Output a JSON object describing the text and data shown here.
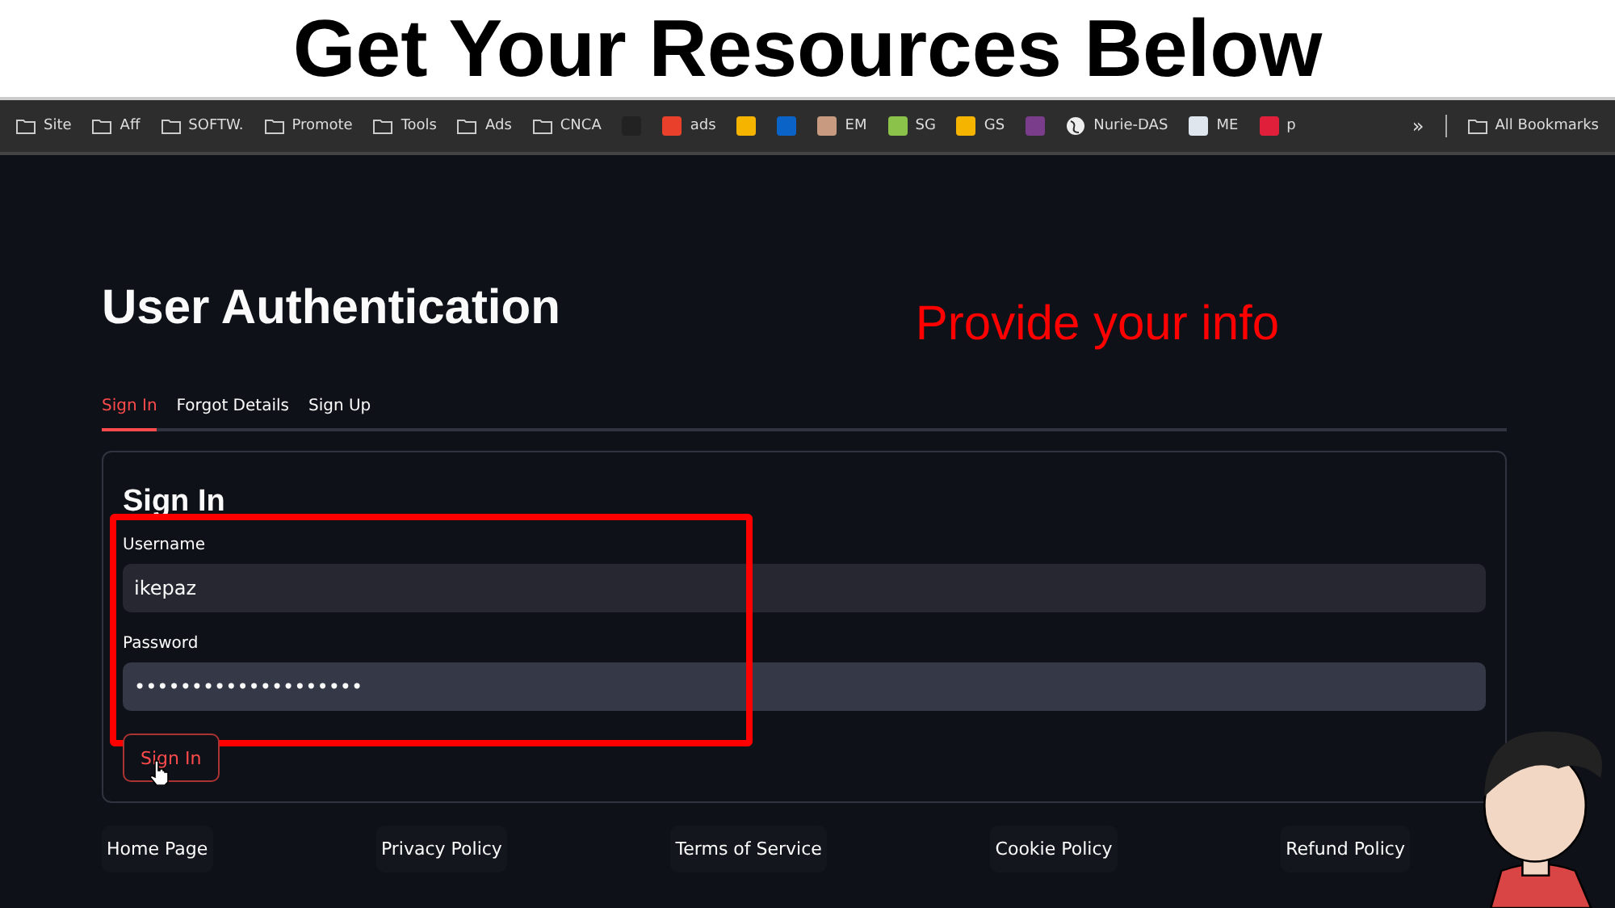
{
  "banner": {
    "title": "Get Your Resources Below"
  },
  "bookmarks": [
    {
      "kind": "folder",
      "label": "Site"
    },
    {
      "kind": "folder",
      "label": "Aff"
    },
    {
      "kind": "folder",
      "label": "SOFTW."
    },
    {
      "kind": "folder",
      "label": "Promote"
    },
    {
      "kind": "folder",
      "label": "Tools"
    },
    {
      "kind": "folder",
      "label": "Ads"
    },
    {
      "kind": "folder",
      "label": "CNCA"
    },
    {
      "kind": "site",
      "color": "#222222"
    },
    {
      "kind": "site",
      "label": "ads",
      "color": "#e8402a"
    },
    {
      "kind": "site",
      "color": "#f4b400"
    },
    {
      "kind": "site",
      "color": "#0a64c8"
    },
    {
      "kind": "site",
      "label": "EM",
      "color": "#c89a80"
    },
    {
      "kind": "site",
      "label": "SG",
      "color": "#8bc34a"
    },
    {
      "kind": "site",
      "label": "GS",
      "color": "#f4b400"
    },
    {
      "kind": "site",
      "color": "#7a3d8c"
    },
    {
      "kind": "globe",
      "label": "Nurie-DAS"
    },
    {
      "kind": "site",
      "label": "ME",
      "color": "#dfe6ee"
    },
    {
      "kind": "site",
      "label": "p",
      "color": "#e0203a"
    }
  ],
  "bookmarks_more": "»",
  "all_bookmarks": "All Bookmarks",
  "page": {
    "title": "User Authentication",
    "annotation": "Provide your info"
  },
  "tabs": [
    {
      "label": "Sign In",
      "selected": true
    },
    {
      "label": "Forgot Details",
      "selected": false
    },
    {
      "label": "Sign Up",
      "selected": false
    }
  ],
  "form": {
    "heading": "Sign In",
    "fields": [
      {
        "label": "Username",
        "value": "ikepaz"
      },
      {
        "label": "Password",
        "value": "••••••••••••••••••••"
      }
    ],
    "button": "Sign In"
  },
  "footer_links": [
    "Home Page",
    "Privacy Policy",
    "Terms of Service",
    "Cookie Policy",
    "Refund Policy"
  ]
}
